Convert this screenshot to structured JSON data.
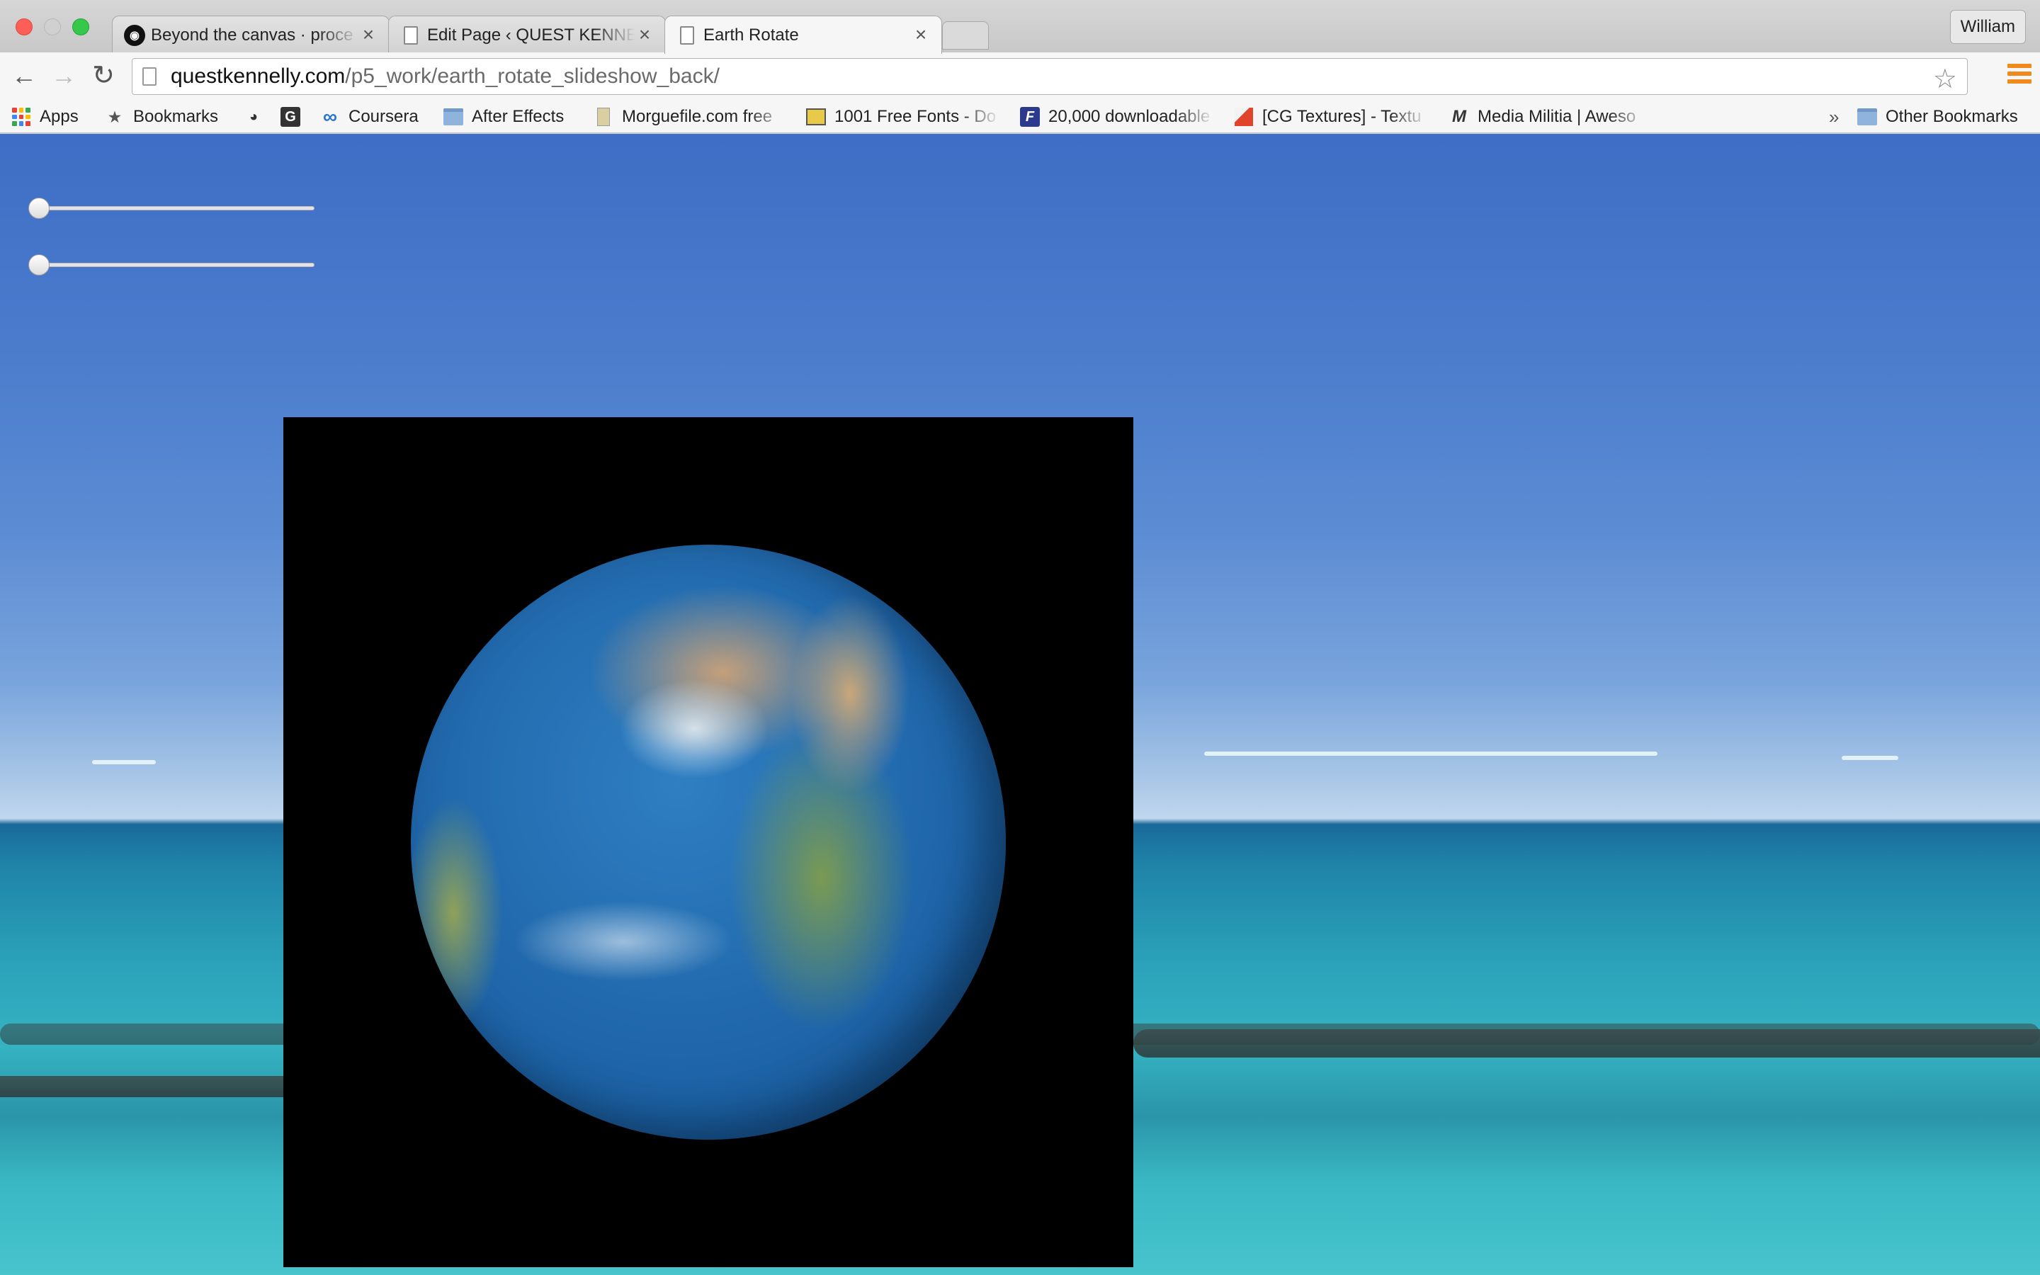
{
  "window": {
    "profile_name": "William"
  },
  "tabs": [
    {
      "title": "Beyond the canvas · proce",
      "icon": "github-icon",
      "active": false
    },
    {
      "title": "Edit Page ‹ QUEST KENNE",
      "icon": "document-icon",
      "active": false
    },
    {
      "title": "Earth Rotate",
      "icon": "document-icon",
      "active": true
    }
  ],
  "toolbar": {
    "back_glyph": "←",
    "forward_glyph": "→",
    "reload_glyph": "↻",
    "url_host": "questkennelly.com",
    "url_path": "/p5_work/earth_rotate_slideshow_back/",
    "star_glyph": "☆"
  },
  "bookmarks": {
    "items": [
      {
        "label": "Apps",
        "icon": "apps-grid-icon"
      },
      {
        "label": "Bookmarks",
        "icon": "star-icon",
        "glyph": "★"
      },
      {
        "label": "",
        "icon": "reddit-icon",
        "glyph": "◕"
      },
      {
        "label": "",
        "icon": "g-icon",
        "glyph": "G"
      },
      {
        "label": "Coursera",
        "icon": "coursera-icon",
        "glyph": "∞"
      },
      {
        "label": "After Effects",
        "icon": "folder-icon"
      },
      {
        "label": "Morguefile.com free",
        "icon": "morguefile-icon"
      },
      {
        "label": "1001 Free Fonts - Do",
        "icon": "fonts-icon"
      },
      {
        "label": "20,000 downloadable",
        "icon": "font-f-icon",
        "glyph": "F"
      },
      {
        "label": "[CG Textures] - Textu",
        "icon": "cgtextures-icon"
      },
      {
        "label": "Media Militia | Aweso",
        "icon": "media-militia-icon",
        "glyph": "M"
      }
    ],
    "overflow_glyph": "»",
    "other_label": "Other Bookmarks"
  },
  "sliders": [
    {
      "value": 0.0
    },
    {
      "value": 0.0
    }
  ],
  "colors": {
    "canvas_bg": "#000000",
    "close_red": "#fc5f57",
    "maximize_green": "#35c84a",
    "menu_orange": "#f08a1c"
  }
}
